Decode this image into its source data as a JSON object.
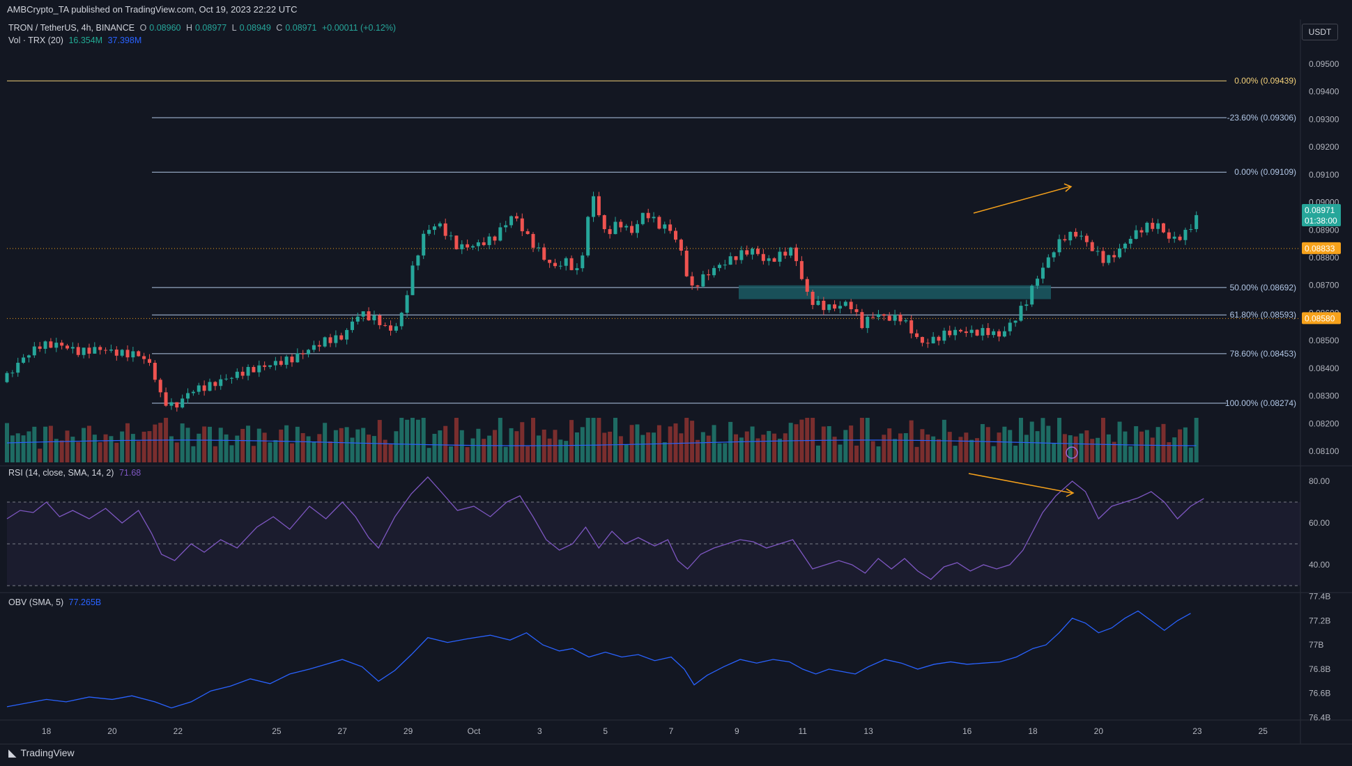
{
  "header": {
    "publisher_line": "AMBCrypto_TA published on TradingView.com, Oct 19, 2023 22:22 UTC"
  },
  "legend": {
    "symbol": "TRON / TetherUS, 4h, BINANCE",
    "open_label": "O",
    "open": "0.08960",
    "high_label": "H",
    "high": "0.08977",
    "low_label": "L",
    "low": "0.08949",
    "close_label": "C",
    "close": "0.08971",
    "change": "+0.00011 (+0.12%)",
    "volume_label": "Vol · TRX (20)",
    "volume_value": "16.354M",
    "volume_ma": "37.398M",
    "rsi_label": "RSI (14, close, SMA, 14, 2)",
    "rsi_value": "71.68",
    "obv_label": "OBV (SMA, 5)",
    "obv_value": "77.265B"
  },
  "price_scale": {
    "unit": "USDT",
    "last_price": "0.08971",
    "countdown": "01:38:00",
    "hline_upper": "0.08833",
    "hline_lower": "0.08580"
  },
  "footer": {
    "brand": "TradingView"
  },
  "colors": {
    "background": "#131722",
    "up": "#26a69a",
    "down": "#ef5350",
    "fib_line": "#b2c7e6",
    "fib_top": "#f5d27a",
    "orange": "#f7a21b",
    "rsi_line": "#7e57c2",
    "obv_line": "#2962ff",
    "zone": "#1b5a63"
  },
  "chart_data": [
    {
      "type": "candlestick",
      "title": "TRON / TetherUS, 4h, BINANCE",
      "x_tick_labels": [
        "18",
        "20",
        "22",
        "25",
        "27",
        "29",
        "Oct",
        "3",
        "5",
        "7",
        "9",
        "11",
        "13",
        "16",
        "18",
        "20",
        "23",
        "25"
      ],
      "y_tick_labels": [
        "0.09500",
        "0.09400",
        "0.09300",
        "0.09200",
        "0.09100",
        "0.09000",
        "0.08900",
        "0.08800",
        "0.08700",
        "0.08600",
        "0.08500",
        "0.08400",
        "0.08300",
        "0.08200",
        "0.08100"
      ],
      "ylim": [
        0.0806,
        0.0955
      ],
      "fib_levels": [
        {
          "label": "0.00% (0.09439)",
          "value": 0.09439
        },
        {
          "label": "-23.60% (0.09306)",
          "value": 0.09306
        },
        {
          "label": "0.00% (0.09109)",
          "value": 0.09109
        },
        {
          "label": "50.00% (0.08692)",
          "value": 0.08692
        },
        {
          "label": "61.80% (0.08593)",
          "value": 0.08593
        },
        {
          "label": "78.60% (0.08453)",
          "value": 0.08453
        },
        {
          "label": "100.00% (0.08274)",
          "value": 0.08274
        }
      ],
      "horizontal_levels": [
        0.08833,
        0.0858
      ],
      "demand_zone": [
        0.0865,
        0.087
      ],
      "close_path": [
        [
          16.8,
          0.0835
        ],
        [
          17.3,
          0.0842
        ],
        [
          17.8,
          0.0847
        ],
        [
          18.4,
          0.0848
        ],
        [
          19.0,
          0.0846
        ],
        [
          19.6,
          0.0848
        ],
        [
          20.2,
          0.0847
        ],
        [
          20.8,
          0.0847
        ],
        [
          21.2,
          0.0843
        ],
        [
          21.5,
          0.0831
        ],
        [
          21.9,
          0.0828
        ],
        [
          22.4,
          0.0834
        ],
        [
          22.9,
          0.0835
        ],
        [
          23.4,
          0.0837
        ],
        [
          24.0,
          0.0839
        ],
        [
          24.5,
          0.084
        ],
        [
          25.0,
          0.0841
        ],
        [
          25.5,
          0.0842
        ],
        [
          26.0,
          0.0845
        ],
        [
          26.5,
          0.0848
        ],
        [
          27.0,
          0.0849
        ],
        [
          27.5,
          0.0858
        ],
        [
          28.0,
          0.0856
        ],
        [
          28.5,
          0.0852
        ],
        [
          28.8,
          0.0858
        ],
        [
          29.1,
          0.0874
        ],
        [
          29.5,
          0.0889
        ],
        [
          29.9,
          0.0893
        ],
        [
          30.5,
          0.0885
        ],
        [
          31.0,
          0.0886
        ],
        [
          31.6,
          0.0889
        ],
        [
          32.2,
          0.0898
        ],
        [
          32.6,
          0.089
        ],
        [
          33.0,
          0.0884
        ],
        [
          33.4,
          0.0878
        ],
        [
          33.8,
          0.088
        ],
        [
          34.2,
          0.0875
        ],
        [
          34.6,
          0.0904
        ],
        [
          35.0,
          0.0888
        ],
        [
          35.4,
          0.0892
        ],
        [
          35.8,
          0.0888
        ],
        [
          36.2,
          0.0895
        ],
        [
          36.6,
          0.089
        ],
        [
          37.0,
          0.0888
        ],
        [
          37.3,
          0.088
        ],
        [
          37.6,
          0.0866
        ],
        [
          37.9,
          0.087
        ],
        [
          38.3,
          0.0874
        ],
        [
          38.7,
          0.0877
        ],
        [
          39.1,
          0.088
        ],
        [
          39.5,
          0.0882
        ],
        [
          39.9,
          0.0878
        ],
        [
          40.3,
          0.0881
        ],
        [
          40.7,
          0.0884
        ],
        [
          40.9,
          0.0876
        ],
        [
          41.2,
          0.0866
        ],
        [
          41.6,
          0.0864
        ],
        [
          42.0,
          0.0864
        ],
        [
          42.4,
          0.0866
        ],
        [
          42.8,
          0.0858
        ],
        [
          43.2,
          0.0862
        ],
        [
          43.6,
          0.086
        ],
        [
          44.0,
          0.086
        ],
        [
          44.3,
          0.0855
        ],
        [
          44.6,
          0.085
        ],
        [
          45.0,
          0.0851
        ],
        [
          45.4,
          0.0853
        ],
        [
          45.8,
          0.0853
        ],
        [
          46.2,
          0.0852
        ],
        [
          46.6,
          0.0852
        ],
        [
          47.0,
          0.085
        ],
        [
          47.4,
          0.0855
        ],
        [
          47.8,
          0.0862
        ],
        [
          48.1,
          0.087
        ],
        [
          48.4,
          0.0876
        ],
        [
          48.7,
          0.0882
        ],
        [
          49.0,
          0.0886
        ],
        [
          49.4,
          0.0887
        ],
        [
          49.8,
          0.0882
        ],
        [
          50.2,
          0.0878
        ],
        [
          50.6,
          0.0882
        ],
        [
          51.0,
          0.0888
        ],
        [
          51.4,
          0.0892
        ],
        [
          51.8,
          0.0893
        ],
        [
          52.2,
          0.0888
        ],
        [
          52.6,
          0.089
        ],
        [
          53.0,
          0.0897
        ]
      ]
    },
    {
      "type": "bar",
      "title": "Vol · TRX (20)",
      "ma_value": "37.398M",
      "current_value": "16.354M"
    },
    {
      "type": "line",
      "title": "RSI (14, close, SMA, 14, 2)",
      "y_tick_labels": [
        "80.00",
        "60.00",
        "40.00"
      ],
      "ylim": [
        27,
        86
      ],
      "bands": [
        70,
        50,
        30
      ],
      "points": [
        [
          16.8,
          62
        ],
        [
          17.2,
          66
        ],
        [
          17.6,
          65
        ],
        [
          18.0,
          70
        ],
        [
          18.4,
          63
        ],
        [
          18.8,
          66
        ],
        [
          19.3,
          62
        ],
        [
          19.8,
          67
        ],
        [
          20.3,
          60
        ],
        [
          20.8,
          66
        ],
        [
          21.2,
          55
        ],
        [
          21.5,
          45
        ],
        [
          21.9,
          42
        ],
        [
          22.4,
          50
        ],
        [
          22.8,
          46
        ],
        [
          23.3,
          52
        ],
        [
          23.8,
          48
        ],
        [
          24.4,
          58
        ],
        [
          24.9,
          63
        ],
        [
          25.4,
          57
        ],
        [
          26.0,
          68
        ],
        [
          26.5,
          62
        ],
        [
          27.0,
          70
        ],
        [
          27.4,
          63
        ],
        [
          27.8,
          53
        ],
        [
          28.1,
          48
        ],
        [
          28.6,
          63
        ],
        [
          29.1,
          74
        ],
        [
          29.6,
          82
        ],
        [
          30.0,
          75
        ],
        [
          30.5,
          66
        ],
        [
          31.0,
          68
        ],
        [
          31.5,
          63
        ],
        [
          32.0,
          70
        ],
        [
          32.4,
          73
        ],
        [
          32.8,
          63
        ],
        [
          33.2,
          52
        ],
        [
          33.6,
          47
        ],
        [
          34.0,
          50
        ],
        [
          34.4,
          58
        ],
        [
          34.8,
          48
        ],
        [
          35.2,
          56
        ],
        [
          35.6,
          50
        ],
        [
          36.0,
          53
        ],
        [
          36.5,
          49
        ],
        [
          36.9,
          52
        ],
        [
          37.2,
          42
        ],
        [
          37.5,
          38
        ],
        [
          37.9,
          45
        ],
        [
          38.3,
          48
        ],
        [
          38.7,
          50
        ],
        [
          39.1,
          52
        ],
        [
          39.5,
          51
        ],
        [
          39.9,
          48
        ],
        [
          40.3,
          50
        ],
        [
          40.7,
          52
        ],
        [
          41.0,
          45
        ],
        [
          41.3,
          38
        ],
        [
          41.7,
          40
        ],
        [
          42.1,
          42
        ],
        [
          42.5,
          40
        ],
        [
          42.9,
          36
        ],
        [
          43.3,
          43
        ],
        [
          43.7,
          38
        ],
        [
          44.1,
          43
        ],
        [
          44.5,
          37
        ],
        [
          44.9,
          33
        ],
        [
          45.3,
          39
        ],
        [
          45.7,
          41
        ],
        [
          46.1,
          37
        ],
        [
          46.5,
          40
        ],
        [
          46.9,
          38
        ],
        [
          47.3,
          40
        ],
        [
          47.7,
          47
        ],
        [
          48.0,
          56
        ],
        [
          48.3,
          65
        ],
        [
          48.7,
          73
        ],
        [
          49.2,
          80
        ],
        [
          49.6,
          75
        ],
        [
          50.0,
          62
        ],
        [
          50.4,
          68
        ],
        [
          50.8,
          70
        ],
        [
          51.2,
          72
        ],
        [
          51.6,
          75
        ],
        [
          52.0,
          70
        ],
        [
          52.4,
          62
        ],
        [
          52.8,
          68
        ],
        [
          53.2,
          71.68
        ]
      ]
    },
    {
      "type": "line",
      "title": "OBV (SMA, 5)",
      "y_tick_labels": [
        "77.4B",
        "77.2B",
        "77B",
        "76.8B",
        "76.6B",
        "76.4B"
      ],
      "ylim": [
        76.38,
        77.42
      ],
      "points": [
        [
          16.8,
          76.49
        ],
        [
          17.4,
          76.52
        ],
        [
          18.0,
          76.55
        ],
        [
          18.6,
          76.53
        ],
        [
          19.3,
          76.57
        ],
        [
          20.0,
          76.55
        ],
        [
          20.6,
          76.58
        ],
        [
          21.3,
          76.53
        ],
        [
          21.8,
          76.48
        ],
        [
          22.4,
          76.53
        ],
        [
          23.0,
          76.62
        ],
        [
          23.6,
          76.66
        ],
        [
          24.2,
          76.72
        ],
        [
          24.8,
          76.68
        ],
        [
          25.4,
          76.76
        ],
        [
          26.0,
          76.8
        ],
        [
          26.5,
          76.84
        ],
        [
          27.0,
          76.88
        ],
        [
          27.6,
          76.82
        ],
        [
          28.1,
          76.7
        ],
        [
          28.6,
          76.79
        ],
        [
          29.1,
          76.92
        ],
        [
          29.6,
          77.06
        ],
        [
          30.2,
          77.02
        ],
        [
          30.8,
          77.05
        ],
        [
          31.5,
          77.08
        ],
        [
          32.1,
          77.04
        ],
        [
          32.6,
          77.1
        ],
        [
          33.1,
          77.0
        ],
        [
          33.6,
          76.95
        ],
        [
          34.0,
          76.97
        ],
        [
          34.5,
          76.9
        ],
        [
          35.0,
          76.94
        ],
        [
          35.5,
          76.9
        ],
        [
          36.0,
          76.92
        ],
        [
          36.5,
          76.87
        ],
        [
          37.0,
          76.9
        ],
        [
          37.4,
          76.8
        ],
        [
          37.7,
          76.67
        ],
        [
          38.1,
          76.75
        ],
        [
          38.6,
          76.82
        ],
        [
          39.1,
          76.88
        ],
        [
          39.6,
          76.85
        ],
        [
          40.1,
          76.88
        ],
        [
          40.6,
          76.86
        ],
        [
          41.0,
          76.8
        ],
        [
          41.4,
          76.76
        ],
        [
          41.8,
          76.8
        ],
        [
          42.2,
          76.78
        ],
        [
          42.6,
          76.76
        ],
        [
          43.0,
          76.82
        ],
        [
          43.5,
          76.88
        ],
        [
          44.0,
          76.85
        ],
        [
          44.5,
          76.8
        ],
        [
          45.0,
          76.84
        ],
        [
          45.5,
          76.86
        ],
        [
          46.0,
          76.84
        ],
        [
          46.5,
          76.85
        ],
        [
          47.0,
          76.86
        ],
        [
          47.5,
          76.9
        ],
        [
          48.0,
          76.97
        ],
        [
          48.4,
          77.0
        ],
        [
          48.8,
          77.1
        ],
        [
          49.2,
          77.22
        ],
        [
          49.6,
          77.18
        ],
        [
          50.0,
          77.1
        ],
        [
          50.4,
          77.14
        ],
        [
          50.8,
          77.22
        ],
        [
          51.2,
          77.28
        ],
        [
          51.6,
          77.2
        ],
        [
          52.0,
          77.12
        ],
        [
          52.4,
          77.2
        ],
        [
          52.8,
          77.26
        ]
      ]
    }
  ]
}
